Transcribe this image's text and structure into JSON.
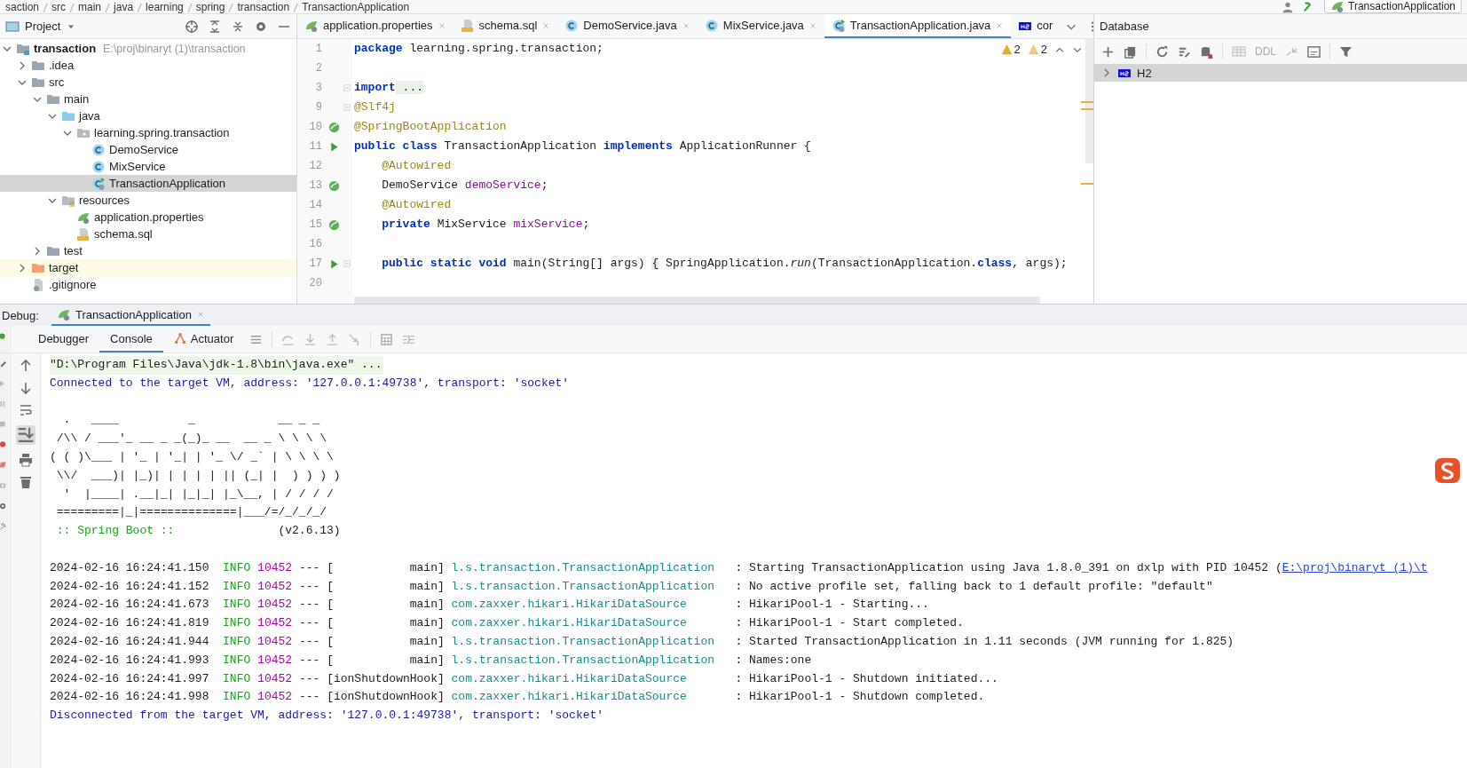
{
  "breadcrumbs": [
    "saction",
    "src",
    "main",
    "java",
    "learning",
    "spring",
    "transaction",
    "TransactionApplication"
  ],
  "run_config": {
    "label": "TransactionApplication"
  },
  "project": {
    "title": "Project",
    "tree": [
      {
        "label": "transaction",
        "kind": "module",
        "path": "E:\\proj\\binaryt (1)\\transaction",
        "expanded": true,
        "selected": false,
        "children": [
          {
            "label": ".idea",
            "kind": "folder",
            "expanded": false,
            "selected": false
          },
          {
            "label": "src",
            "kind": "folder",
            "expanded": true,
            "selected": false,
            "children": [
              {
                "label": "main",
                "kind": "folder",
                "expanded": true,
                "selected": false,
                "children": [
                  {
                    "label": "java",
                    "kind": "source-folder",
                    "expanded": true,
                    "selected": false,
                    "children": [
                      {
                        "label": "learning.spring.transaction",
                        "kind": "package",
                        "expanded": true,
                        "selected": false,
                        "children": [
                          {
                            "label": "DemoService",
                            "kind": "class",
                            "selected": false
                          },
                          {
                            "label": "MixService",
                            "kind": "class",
                            "selected": false
                          },
                          {
                            "label": "TransactionApplication",
                            "kind": "app-class",
                            "selected": true
                          }
                        ]
                      }
                    ]
                  },
                  {
                    "label": "resources",
                    "kind": "resources",
                    "expanded": true,
                    "selected": false,
                    "children": [
                      {
                        "label": "application.properties",
                        "kind": "properties",
                        "selected": false
                      },
                      {
                        "label": "schema.sql",
                        "kind": "sql",
                        "selected": false
                      }
                    ]
                  }
                ]
              },
              {
                "label": "test",
                "kind": "folder",
                "expanded": false,
                "selected": false
              }
            ]
          },
          {
            "label": "target",
            "kind": "excluded-folder",
            "expanded": false,
            "selected": false
          },
          {
            "label": ".gitignore",
            "kind": "file",
            "selected": false
          }
        ]
      }
    ]
  },
  "editor": {
    "tabs": [
      {
        "label": "application.properties",
        "kind": "properties",
        "selected": false
      },
      {
        "label": "schema.sql",
        "kind": "sql",
        "selected": false
      },
      {
        "label": "DemoService.java",
        "kind": "class",
        "selected": false
      },
      {
        "label": "MixService.java",
        "kind": "class",
        "selected": false
      },
      {
        "label": "TransactionApplication.java",
        "kind": "app-class",
        "selected": true
      },
      {
        "label": "cor",
        "kind": "h2",
        "selected": false
      }
    ],
    "inspections": [
      {
        "kind": "warning",
        "count": "2"
      },
      {
        "kind": "weak-warning",
        "count": "2"
      }
    ],
    "lines": [
      {
        "number": "1",
        "kind": "plain",
        "fold": false,
        "tokens": [
          {
            "kind": "keyword",
            "text": "package"
          },
          {
            "kind": "plain",
            "text": " learning.spring.transaction;"
          }
        ]
      },
      {
        "number": "2",
        "kind": "plain",
        "fold": false
      },
      {
        "number": "3",
        "kind": "plain",
        "fold": true,
        "tokens": [
          {
            "kind": "keyword",
            "text": "import"
          },
          {
            "kind": "folded",
            "text": " ..."
          }
        ]
      },
      {
        "number": "9",
        "kind": "plain",
        "fold": true,
        "tokens": [
          {
            "kind": "annotation",
            "text": "@Slf4j"
          }
        ]
      },
      {
        "number": "10",
        "kind": "bean",
        "fold": false,
        "tokens": [
          {
            "kind": "annotation",
            "text": "@SpringBootApplication"
          }
        ]
      },
      {
        "number": "11",
        "kind": "run",
        "fold": false,
        "tokens": [
          {
            "kind": "keyword",
            "text": "public class"
          },
          {
            "kind": "plain",
            "text": " TransactionApplication "
          },
          {
            "kind": "keyword",
            "text": "implements"
          },
          {
            "kind": "plain",
            "text": " ApplicationRunner {"
          }
        ]
      },
      {
        "number": "12",
        "kind": "plain",
        "fold": false,
        "tokens": [
          {
            "kind": "annotation",
            "text": "    @Autowired"
          }
        ]
      },
      {
        "number": "13",
        "kind": "bean",
        "fold": false,
        "tokens": [
          {
            "kind": "plain",
            "text": "    DemoService "
          },
          {
            "kind": "field",
            "text": "demoService"
          },
          {
            "kind": "plain",
            "text": ";"
          }
        ]
      },
      {
        "number": "14",
        "kind": "plain",
        "fold": false,
        "tokens": [
          {
            "kind": "annotation",
            "text": "    @Autowired"
          }
        ]
      },
      {
        "number": "15",
        "kind": "bean",
        "fold": false,
        "tokens": [
          {
            "kind": "keyword",
            "text": "    private"
          },
          {
            "kind": "plain",
            "text": " MixService "
          },
          {
            "kind": "field",
            "text": "mixService"
          },
          {
            "kind": "plain",
            "text": ";"
          }
        ]
      },
      {
        "number": "16",
        "kind": "plain",
        "fold": false
      },
      {
        "number": "17",
        "kind": "run",
        "fold": true,
        "tokens": [
          {
            "kind": "keyword",
            "text": "    public static void"
          },
          {
            "kind": "plain",
            "text": " main(String[] args) "
          },
          {
            "kind": "brace",
            "text": "{"
          },
          {
            "kind": "plain",
            "text": " SpringApplication."
          },
          {
            "kind": "italic",
            "text": "run"
          },
          {
            "kind": "plain",
            "text": "(TransactionApplication."
          },
          {
            "kind": "keyword",
            "text": "class"
          },
          {
            "kind": "plain",
            "text": ", args);"
          }
        ]
      },
      {
        "number": "20",
        "kind": "plain",
        "fold": false
      }
    ]
  },
  "database": {
    "title": "Database",
    "ddl": "DDL",
    "tree": [
      {
        "label": "H2",
        "expanded": false,
        "selected": true
      }
    ]
  },
  "debug": {
    "label": "Debug:",
    "tabs": [
      {
        "label": "TransactionApplication",
        "selected": true
      }
    ],
    "tool_tabs": [
      {
        "label": "Debugger",
        "kind": "plain",
        "selected": false
      },
      {
        "label": "Console",
        "kind": "plain",
        "selected": true
      },
      {
        "label": "Actuator",
        "kind": "actuator",
        "selected": false
      }
    ],
    "console": [
      {
        "kind": "command",
        "text": "\"D:\\Program Files\\Java\\jdk-1.8\\bin\\java.exe\" ..."
      },
      {
        "kind": "system",
        "text": "Connected to the target VM, address: '127.0.0.1:49738', transport: 'socket'"
      },
      {
        "kind": "blank"
      },
      {
        "kind": "banner",
        "text": "  .   ____          _            __ _ _"
      },
      {
        "kind": "banner",
        "text": " /\\\\ / ___'_ __ _ _(_)_ __  __ _ \\ \\ \\ \\"
      },
      {
        "kind": "banner",
        "text": "( ( )\\___ | '_ | '_| | '_ \\/ _` | \\ \\ \\ \\"
      },
      {
        "kind": "banner",
        "text": " \\\\/  ___)| |_)| | | | | || (_| |  ) ) ) )"
      },
      {
        "kind": "banner",
        "text": "  '  |____| .__|_| |_|_| |_\\__, | / / / /"
      },
      {
        "kind": "banner",
        "text": " =========|_|==============|___/=/_/_/_/"
      },
      {
        "kind": "version",
        "label": ":: Spring Boot ::",
        "version": "(v2.6.13)"
      },
      {
        "kind": "blank"
      },
      {
        "kind": "log",
        "time": "2024-02-16 16:24:41.150",
        "level": "INFO",
        "pid": "10452",
        "sep": "---",
        "thread": "[           main]",
        "logger": "l.s.transaction.TransactionApplication",
        "message": ": Starting TransactionApplication using Java 1.8.0_391 on dxlp with PID 10452 (",
        "link": "E:\\proj\\binaryt (1)\\t"
      },
      {
        "kind": "log",
        "time": "2024-02-16 16:24:41.152",
        "level": "INFO",
        "pid": "10452",
        "sep": "---",
        "thread": "[           main]",
        "logger": "l.s.transaction.TransactionApplication",
        "message": ": No active profile set, falling back to 1 default profile: \"default\""
      },
      {
        "kind": "log",
        "time": "2024-02-16 16:24:41.673",
        "level": "INFO",
        "pid": "10452",
        "sep": "---",
        "thread": "[           main]",
        "logger": "com.zaxxer.hikari.HikariDataSource",
        "message": ": HikariPool-1 - Starting..."
      },
      {
        "kind": "log",
        "time": "2024-02-16 16:24:41.819",
        "level": "INFO",
        "pid": "10452",
        "sep": "---",
        "thread": "[           main]",
        "logger": "com.zaxxer.hikari.HikariDataSource",
        "message": ": HikariPool-1 - Start completed."
      },
      {
        "kind": "log",
        "time": "2024-02-16 16:24:41.944",
        "level": "INFO",
        "pid": "10452",
        "sep": "---",
        "thread": "[           main]",
        "logger": "l.s.transaction.TransactionApplication",
        "message": ": Started TransactionApplication in 1.11 seconds (JVM running for 1.825)"
      },
      {
        "kind": "log",
        "time": "2024-02-16 16:24:41.993",
        "level": "INFO",
        "pid": "10452",
        "sep": "---",
        "thread": "[           main]",
        "logger": "l.s.transaction.TransactionApplication",
        "message": ": Names:one"
      },
      {
        "kind": "log",
        "time": "2024-02-16 16:24:41.997",
        "level": "INFO",
        "pid": "10452",
        "sep": "---",
        "thread": "[ionShutdownHook]",
        "logger": "com.zaxxer.hikari.HikariDataSource",
        "message": ": HikariPool-1 - Shutdown initiated..."
      },
      {
        "kind": "log",
        "time": "2024-02-16 16:24:41.998",
        "level": "INFO",
        "pid": "10452",
        "sep": "---",
        "thread": "[ionShutdownHook]",
        "logger": "com.zaxxer.hikari.HikariDataSource",
        "message": ": HikariPool-1 - Shutdown completed."
      },
      {
        "kind": "system",
        "text": "Disconnected from the target VM, address: '127.0.0.1:49738', transport: 'socket'"
      }
    ]
  }
}
